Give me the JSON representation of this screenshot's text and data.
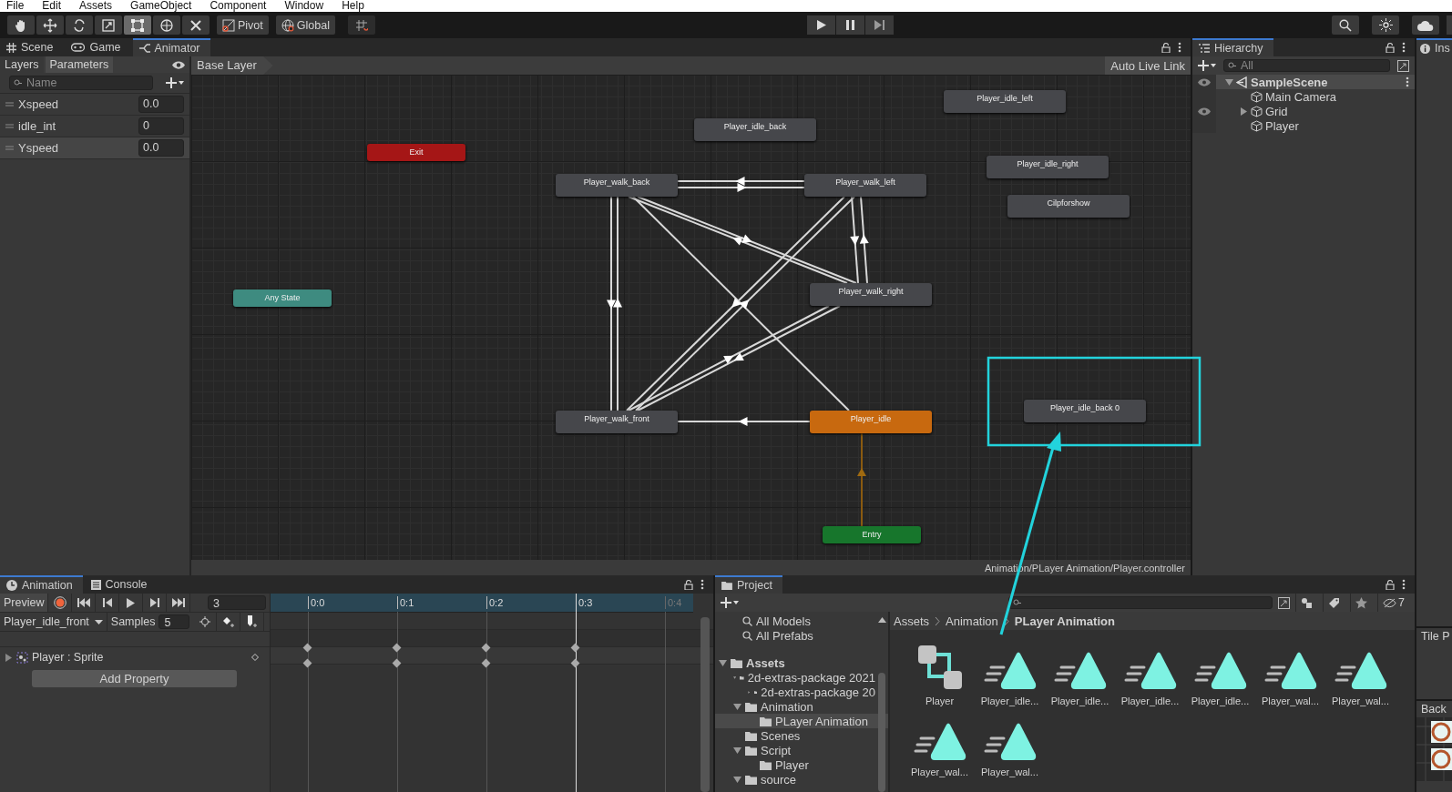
{
  "menu": [
    "File",
    "Edit",
    "Assets",
    "GameObject",
    "Component",
    "Window",
    "Help"
  ],
  "toolbar": {
    "tools": [
      {
        "kind": "hand",
        "selected": false
      },
      {
        "kind": "move",
        "selected": false
      },
      {
        "kind": "rotate",
        "selected": false
      },
      {
        "kind": "scale",
        "selected": false
      },
      {
        "kind": "rect",
        "selected": true
      },
      {
        "kind": "transform",
        "selected": false
      },
      {
        "kind": "custom",
        "selected": false
      }
    ],
    "pivot": "Pivot",
    "space": "Global"
  },
  "top_tabs": [
    {
      "label": "Scene",
      "kind": "scene",
      "selected": false
    },
    {
      "label": "Game",
      "kind": "game",
      "selected": false
    },
    {
      "label": "Animator",
      "kind": "animator",
      "selected": true
    }
  ],
  "animator": {
    "side_tabs": [
      {
        "label": "Layers",
        "selected": false
      },
      {
        "label": "Parameters",
        "selected": true
      }
    ],
    "search": {
      "placeholder": "Name"
    },
    "parameters": [
      {
        "name": "Xspeed",
        "value": "0.0",
        "selected": false
      },
      {
        "name": "idle_int",
        "value": "0",
        "selected": false
      },
      {
        "name": "Yspeed",
        "value": "0.0",
        "selected": true
      }
    ],
    "breadcrumb": "Base Layer",
    "live_link": "Auto Live Link",
    "states": [
      {
        "name": "Player_idle_left",
        "kind": "state"
      },
      {
        "name": "Player_idle_back",
        "kind": "state"
      },
      {
        "name": "Exit",
        "kind": "exit"
      },
      {
        "name": "Player_idle_right",
        "kind": "state"
      },
      {
        "name": "Player_walk_back",
        "kind": "state"
      },
      {
        "name": "Player_walk_left",
        "kind": "state"
      },
      {
        "name": "Cilpforshow",
        "kind": "state"
      },
      {
        "name": "Player_walk_right",
        "kind": "state"
      },
      {
        "name": "Any State",
        "kind": "any"
      },
      {
        "name": "Player_idle_back 0",
        "kind": "state"
      },
      {
        "name": "Player_walk_front",
        "kind": "state"
      },
      {
        "name": "Player_idle",
        "kind": "default"
      },
      {
        "name": "Entry",
        "kind": "entry"
      }
    ],
    "path": "Animation/PLayer Animation/Player.controller"
  },
  "hierarchy": {
    "title": "Hierarchy",
    "search": {
      "placeholder": "All"
    },
    "items": [
      {
        "name": "SampleScene",
        "kind": "scene",
        "expanded": true,
        "eye": true,
        "selected": true,
        "children": [
          {
            "name": "Main Camera",
            "kind": "object",
            "eye": false,
            "selected": false
          },
          {
            "name": "Grid",
            "kind": "object",
            "expanded": false,
            "eye": true,
            "selected": false
          },
          {
            "name": "Player",
            "kind": "object",
            "eye": false,
            "selected": false
          }
        ]
      }
    ]
  },
  "inspector": {
    "title": "Ins"
  },
  "side_panels": {
    "tile_palette": "Tile P",
    "palette": "Back"
  },
  "animation": {
    "tabs": [
      {
        "label": "Animation",
        "kind": "animation",
        "selected": true
      },
      {
        "label": "Console",
        "kind": "console",
        "selected": false
      }
    ],
    "preview": "Preview",
    "frame": "3",
    "clip": "Player_idle_front",
    "samples_label": "Samples",
    "samples": "5",
    "ticks": [
      {
        "label": "0:0",
        "disabled": false,
        "current": false
      },
      {
        "label": "0:1",
        "disabled": false,
        "current": false
      },
      {
        "label": "0:2",
        "disabled": false,
        "current": false
      },
      {
        "label": "0:3",
        "disabled": false,
        "current": true
      },
      {
        "label": "0:4",
        "disabled": true,
        "current": false
      }
    ],
    "tracks": [
      {
        "name": "Player : Sprite",
        "expanded": false
      }
    ],
    "add_property": "Add Property"
  },
  "project": {
    "title": "Project",
    "hidden_count": "7",
    "favorites": [
      "All Models",
      "All Prefabs"
    ],
    "tree": [
      {
        "name": "Assets",
        "expanded": true,
        "selected": false,
        "children": [
          {
            "name": "2d-extras-package 2021",
            "expanded": true,
            "selected": false,
            "children": [
              {
                "name": "2d-extras-package 20",
                "expanded": false,
                "selected": false
              }
            ]
          },
          {
            "name": "Animation",
            "expanded": true,
            "selected": false,
            "children": [
              {
                "name": "PLayer Animation",
                "selected": true
              }
            ]
          },
          {
            "name": "Scenes",
            "selected": false
          },
          {
            "name": "Script",
            "expanded": true,
            "selected": false,
            "children": [
              {
                "name": "Player",
                "selected": false
              }
            ]
          },
          {
            "name": "source",
            "expanded": true,
            "selected": false
          }
        ]
      }
    ],
    "breadcrumb": [
      "Assets",
      "Animation",
      "PLayer Animation"
    ],
    "assets": [
      {
        "name": "Player",
        "kind": "controller"
      },
      {
        "name": "Player_idle...",
        "kind": "clip"
      },
      {
        "name": "Player_idle...",
        "kind": "clip"
      },
      {
        "name": "Player_idle...",
        "kind": "clip"
      },
      {
        "name": "Player_idle...",
        "kind": "clip"
      },
      {
        "name": "Player_wal...",
        "kind": "clip"
      },
      {
        "name": "Player_wal...",
        "kind": "clip"
      },
      {
        "name": "Player_wal...",
        "kind": "clip"
      },
      {
        "name": "Player_wal...",
        "kind": "clip"
      }
    ]
  }
}
